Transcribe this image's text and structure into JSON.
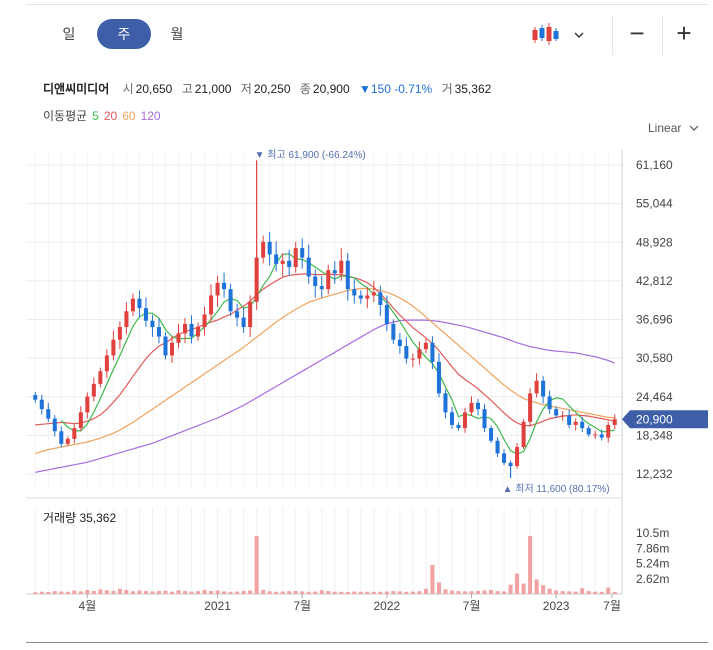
{
  "period_tabs": [
    {
      "label": "일"
    },
    {
      "label": "주"
    },
    {
      "label": "월"
    }
  ],
  "active_tab": "주",
  "chart_type_icon": "candlestick-icon",
  "zoom": {
    "out_label": "−",
    "in_label": "+"
  },
  "ohlc": {
    "name": "디앤씨미디어",
    "open_label": "시",
    "open": "20,650",
    "high_label": "고",
    "high": "21,000",
    "low_label": "저",
    "low": "20,250",
    "close_label": "종",
    "close": "20,900",
    "change": "▼150 -0.71%",
    "volume_label": "거",
    "volume": "35,362"
  },
  "ma_legend": {
    "label": "이동평균",
    "p5": "5",
    "p20": "20",
    "p60": "60",
    "p120": "120"
  },
  "scale_mode": "Linear",
  "volume_label": "거래량 35,362",
  "colors": {
    "up": "#e0413f",
    "down": "#1e73d8",
    "ma5": "#3fb94c",
    "ma20": "#e35a5a",
    "ma60": "#f0a35c",
    "ma120": "#a86ce0",
    "accent": "#3f5ea8",
    "volume": "#f2a2a2"
  },
  "chart_data": {
    "type": "candlestick",
    "yticks": [
      "61,160",
      "55,044",
      "48,928",
      "42,812",
      "36,696",
      "30,580",
      "24,464",
      "18,348",
      "12,232"
    ],
    "ylim": [
      12232,
      61160
    ],
    "vticks": [
      "10.5m",
      "7.86m",
      "5.24m",
      "2.62m"
    ],
    "vlim": [
      0,
      10500000
    ],
    "xticks": [
      "4월",
      "2021",
      "7월",
      "2022",
      "7월",
      "2023",
      "7월"
    ],
    "current_price": "20,900",
    "max_label": "▼ 최고 61,900 (-66.24%)",
    "min_label": "▲ 최저 11,600 (80.17%)",
    "close": [
      24000,
      22500,
      21000,
      19000,
      17000,
      17800,
      19500,
      22000,
      24500,
      26500,
      28500,
      31000,
      33500,
      35500,
      38000,
      40000,
      38500,
      36500,
      35500,
      34000,
      31000,
      33000,
      34500,
      36000,
      34000,
      35500,
      37500,
      40500,
      42500,
      41500,
      38000,
      37000,
      35500,
      39500,
      46500,
      49000,
      47000,
      45500,
      46000,
      45000,
      48000,
      46500,
      43500,
      42000,
      41500,
      44500,
      44000,
      46000,
      41500,
      40500,
      40000,
      40500,
      41000,
      39000,
      36000,
      33500,
      32500,
      30500,
      30500,
      32000,
      33000,
      30000,
      25000,
      22000,
      20000,
      19500,
      22000,
      23500,
      22500,
      19500,
      17500,
      15500,
      14000,
      13500,
      16500,
      20500,
      25000,
      27000,
      24500,
      22500,
      21500,
      21500,
      20000,
      20500,
      19500,
      18500,
      18500,
      18000,
      20000,
      20900
    ],
    "ma5": [
      null,
      null,
      null,
      null,
      20700,
      19660,
      19060,
      19060,
      20160,
      22060,
      24200,
      26500,
      28800,
      31000,
      33300,
      35600,
      37100,
      37700,
      37700,
      36900,
      35100,
      34000,
      33600,
      33700,
      33700,
      34600,
      35500,
      36700,
      38000,
      39500,
      40000,
      39700,
      38500,
      38700,
      40300,
      42100,
      43500,
      45700,
      47000,
      47100,
      46300,
      46200,
      45700,
      45000,
      44300,
      43600,
      43100,
      43600,
      43500,
      43300,
      42400,
      41700,
      40700,
      40400,
      39300,
      37800,
      36400,
      34700,
      33100,
      31900,
      30700,
      29700,
      28200,
      26000,
      24000,
      21300,
      21700,
      21500,
      21000,
      21300,
      21000,
      19700,
      17700,
      15900,
      15400,
      15800,
      17800,
      20500,
      22500,
      23800,
      24300,
      24100,
      23000,
      22000,
      21000,
      20200,
      19600,
      18900,
      19000,
      19200
    ],
    "ma20": [
      20000,
      20100,
      20200,
      20300,
      20400,
      20300,
      20200,
      20300,
      20600,
      21000,
      21600,
      22500,
      23600,
      24800,
      26200,
      27700,
      29100,
      30500,
      31600,
      32500,
      33000,
      33700,
      34300,
      34800,
      35100,
      35500,
      35900,
      36300,
      36600,
      37100,
      37500,
      38200,
      38800,
      39600,
      40600,
      41500,
      42200,
      42800,
      43400,
      43700,
      43800,
      43900,
      43900,
      43800,
      43800,
      43900,
      43800,
      43800,
      43600,
      43300,
      43000,
      42500,
      41800,
      40800,
      39700,
      38500,
      37400,
      36400,
      35400,
      34600,
      33800,
      32900,
      31800,
      30500,
      29200,
      28000,
      27200,
      26500,
      25700,
      24800,
      23900,
      22900,
      21900,
      21000,
      20300,
      19900,
      19900,
      20200,
      20600,
      21000,
      21200,
      21400,
      21500,
      21600,
      21500,
      21400,
      21200,
      21000,
      20800,
      20600
    ],
    "ma60": [
      15500,
      15800,
      16100,
      16300,
      16500,
      16700,
      16900,
      17100,
      17300,
      17600,
      17900,
      18300,
      18700,
      19200,
      19800,
      20400,
      21100,
      21800,
      22500,
      23200,
      23900,
      24600,
      25300,
      26000,
      26700,
      27400,
      28100,
      28800,
      29500,
      30200,
      30900,
      31600,
      32300,
      33100,
      33900,
      34700,
      35500,
      36300,
      37000,
      37700,
      38300,
      38900,
      39400,
      39800,
      40100,
      40400,
      40700,
      41000,
      41300,
      41500,
      41600,
      41600,
      41500,
      41300,
      41000,
      40600,
      40100,
      39500,
      38800,
      38000,
      37100,
      36200,
      35300,
      34400,
      33500,
      32600,
      31700,
      30800,
      29900,
      29000,
      28100,
      27200,
      26300,
      25500,
      24800,
      24200,
      23800,
      23500,
      23200,
      23000,
      22800,
      22600,
      22400,
      22200,
      22000,
      21800,
      21600,
      21400,
      21200,
      21100
    ],
    "ma120": [
      12500,
      12700,
      12900,
      13100,
      13300,
      13500,
      13700,
      13900,
      14100,
      14400,
      14700,
      15000,
      15300,
      15600,
      15900,
      16200,
      16500,
      16800,
      17100,
      17500,
      17900,
      18300,
      18700,
      19100,
      19500,
      19900,
      20300,
      20700,
      21100,
      21600,
      22100,
      22600,
      23100,
      23700,
      24300,
      24900,
      25500,
      26100,
      26700,
      27300,
      27900,
      28500,
      29100,
      29700,
      30300,
      30900,
      31500,
      32100,
      32700,
      33300,
      33900,
      34500,
      35100,
      35600,
      36000,
      36300,
      36500,
      36600,
      36600,
      36600,
      36600,
      36500,
      36400,
      36200,
      36000,
      35800,
      35600,
      35300,
      35000,
      34700,
      34400,
      34100,
      33800,
      33400,
      33000,
      32700,
      32400,
      32200,
      32000,
      31800,
      31700,
      31600,
      31500,
      31400,
      31200,
      31000,
      30800,
      30500,
      30200,
      29800
    ],
    "volume": [
      300000,
      400000,
      350000,
      500000,
      420000,
      380000,
      600000,
      450000,
      700000,
      520000,
      800000,
      650000,
      550000,
      900000,
      700000,
      480000,
      600000,
      500000,
      450000,
      520000,
      580000,
      400000,
      650000,
      500000,
      420000,
      480000,
      700000,
      520000,
      610000,
      450000,
      380000,
      420000,
      550000,
      600000,
      10000000,
      700000,
      450000,
      380000,
      420000,
      480000,
      520000,
      450000,
      380000,
      420000,
      650000,
      500000,
      400000,
      380000,
      350000,
      420000,
      380000,
      400000,
      360000,
      380000,
      420000,
      500000,
      450000,
      380000,
      420000,
      480000,
      900000,
      5000000,
      2000000,
      800000,
      600000,
      500000,
      450000,
      480000,
      520000,
      600000,
      700000,
      500000,
      450000,
      1600000,
      3500000,
      1800000,
      10000000,
      2500000,
      1500000,
      900000,
      600000,
      500000,
      450000,
      400000,
      1000000,
      500000,
      400000,
      380000,
      1100000,
      350000
    ]
  }
}
